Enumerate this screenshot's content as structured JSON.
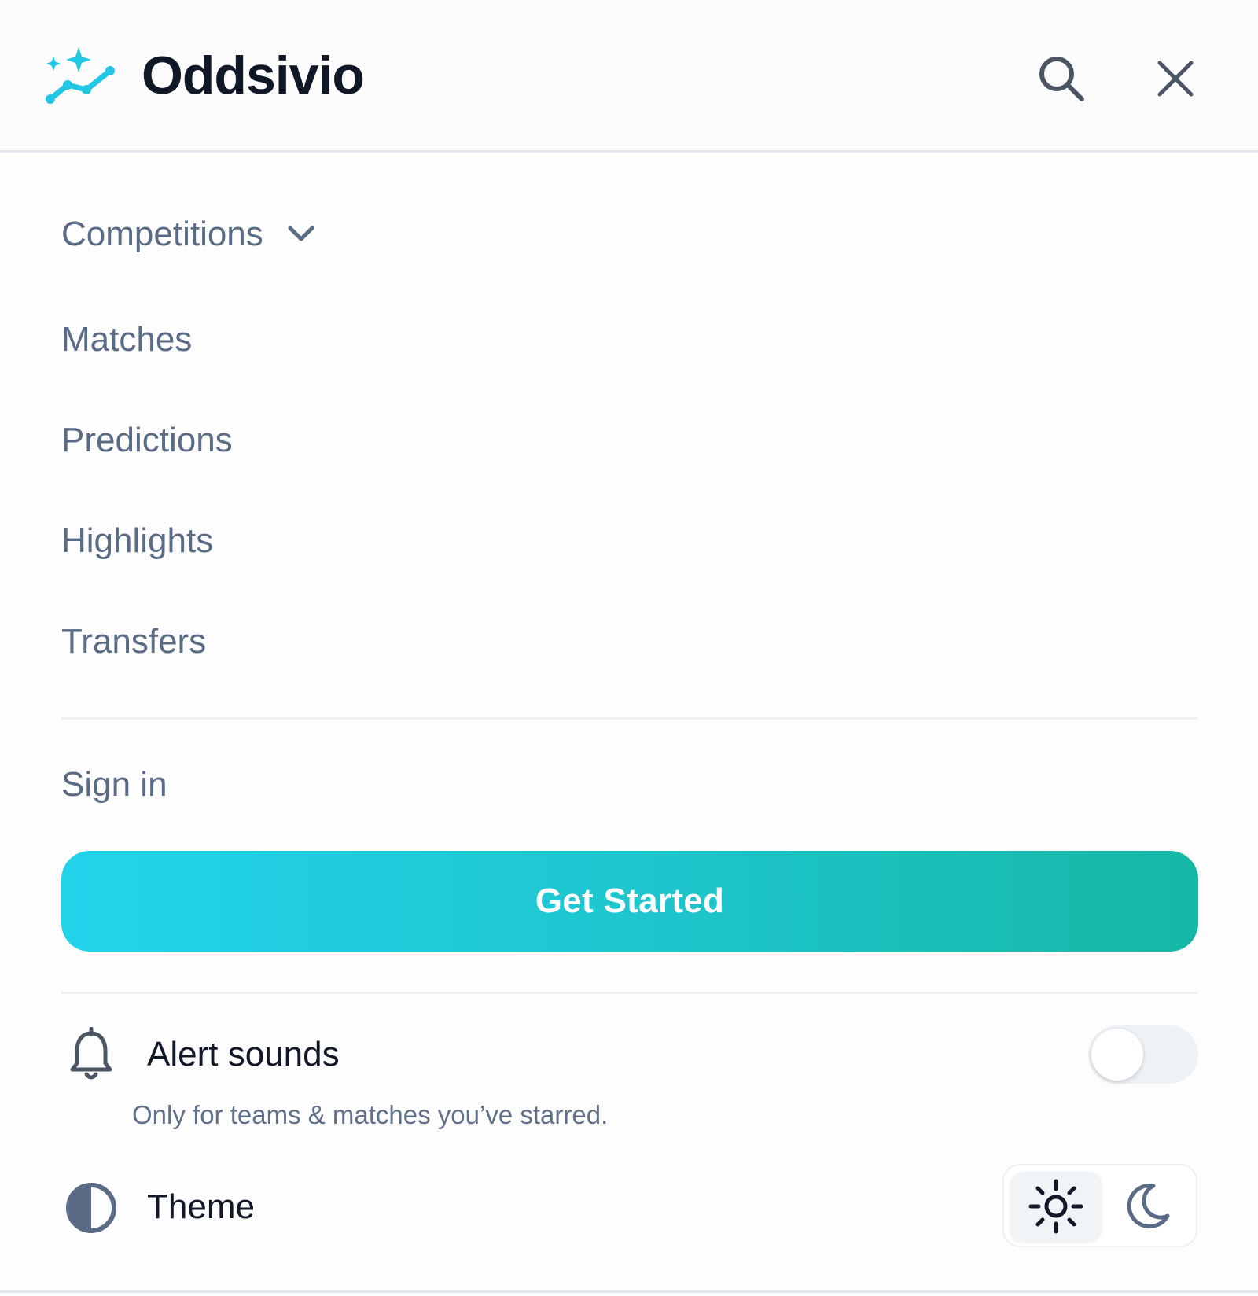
{
  "brand": {
    "name": "Oddsivio",
    "logo_icon": "sparkle-chart-icon",
    "accent": "#22d3eb"
  },
  "header": {
    "search_icon": "search-icon",
    "close_icon": "close-icon"
  },
  "nav": {
    "competitions": "Competitions",
    "matches": "Matches",
    "predictions": "Predictions",
    "highlights": "Highlights",
    "transfers": "Transfers"
  },
  "auth": {
    "sign_in": "Sign in",
    "get_started": "Get Started"
  },
  "settings": {
    "alert_sounds": {
      "label": "Alert sounds",
      "description": "Only for teams & matches you’ve starred.",
      "enabled": false,
      "icon": "bell-icon"
    },
    "theme": {
      "label": "Theme",
      "selected": "light",
      "icon": "contrast-icon",
      "options": [
        "light",
        "dark"
      ]
    }
  },
  "colors": {
    "text_primary": "#111827",
    "text_muted": "#5a6b85",
    "gradient_start": "#22d3eb",
    "gradient_end": "#15b8a5"
  }
}
